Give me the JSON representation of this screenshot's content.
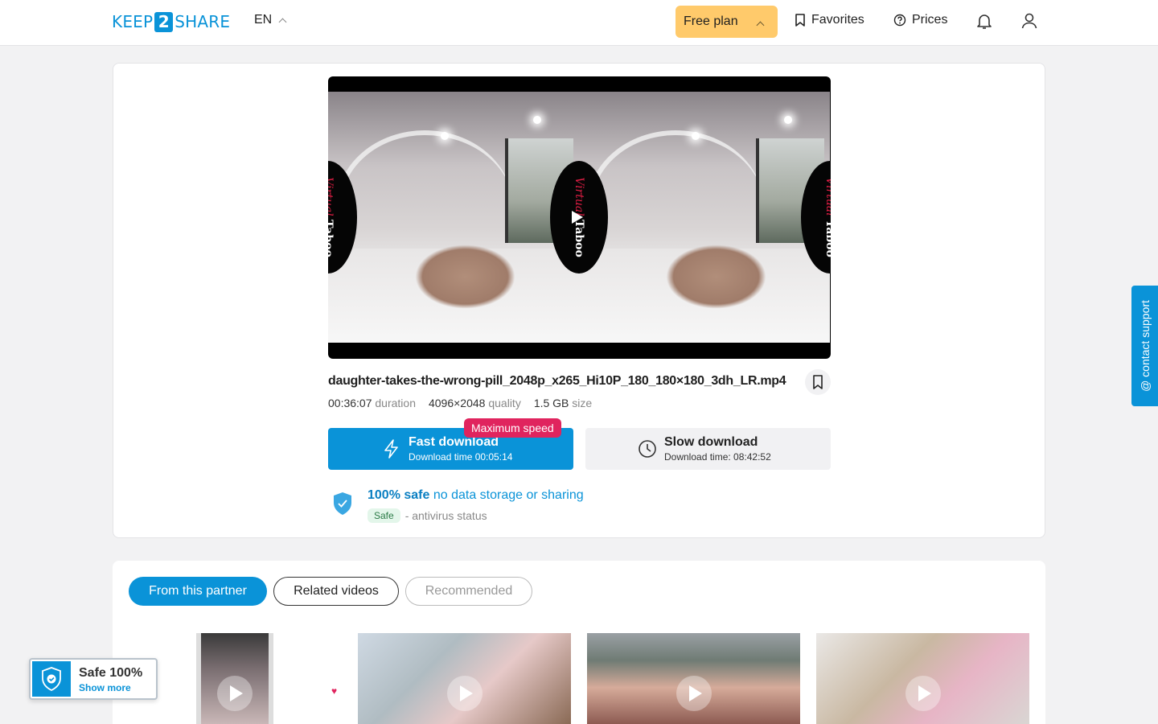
{
  "header": {
    "logo_left": "KEEP",
    "logo_num": "2",
    "logo_right": "SHARE",
    "language": "EN",
    "plan_label": "Free plan",
    "favorites_label": "Favorites",
    "prices_label": "Prices"
  },
  "player": {
    "badge_word1": "Virtual",
    "badge_word2": "Taboo"
  },
  "file": {
    "name": "daughter-takes-the-wrong-pill_2048p_x265_Hi10P_180_180×180_3dh_LR.mp4",
    "duration_value": "00:36:07",
    "duration_label": "duration",
    "quality_value": "4096×2048",
    "quality_label": "quality",
    "size_value": "1.5 GB",
    "size_label": "size"
  },
  "download": {
    "fast_label": "Fast download",
    "fast_time": "Download time 00:05:14",
    "max_speed_badge": "Maximum speed",
    "slow_label": "Slow download",
    "slow_time": "Download time: 08:42:52"
  },
  "safety": {
    "safe_bold": "100% safe",
    "safe_text": "no data storage or sharing",
    "status_pill": "Safe",
    "status_text": "- antivirus status"
  },
  "support": {
    "label": "@ contact support"
  },
  "tabs": [
    {
      "label": "From this partner",
      "active": true
    },
    {
      "label": "Related videos",
      "active": false
    },
    {
      "label": "Recommended",
      "active": false
    }
  ],
  "widget": {
    "title": "Safe 100%",
    "link": "Show more"
  },
  "colors": {
    "accent": "#0a93d8",
    "plan": "#ffca6b",
    "badge": "#e0245e"
  }
}
